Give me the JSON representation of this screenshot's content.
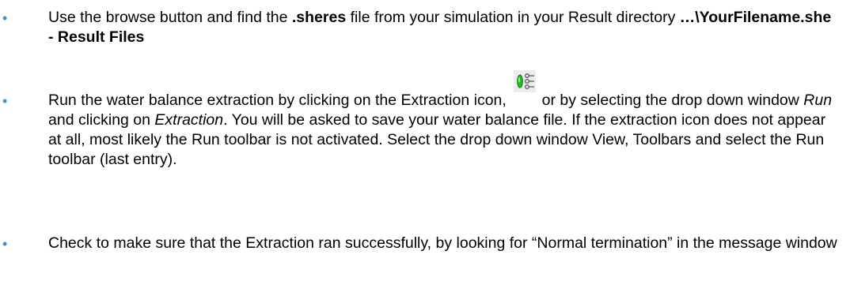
{
  "colors": {
    "bullet": "#3d8fd6",
    "icon_green": "#19c419",
    "icon_line": "#5a5a5a"
  },
  "bullets": {
    "marker": "•",
    "item1": {
      "p1": "Use the browse button and find the ",
      "b1": ".sheres",
      "p2": " file from your simulation in your Result directory ",
      "b2": "…\\YourFilename.she - Result Files"
    },
    "item2": {
      "p1": "Run the water balance extraction by clicking on the Extraction icon, ",
      "icon_name": "extraction-icon",
      "p2": " or by selecting the drop down window ",
      "i1": "Run",
      "p3": " and clicking on ",
      "i2": "Extraction",
      "p4": ". You will be asked to save your water balance file. If the extraction icon does not appear at all, most likely the Run toolbar is not activated. Select the drop down window View, Toolbars and select the Run toolbar (last entry)."
    },
    "item3": {
      "p1": "Check to make sure that the Extraction ran successfully, by looking for “Normal termination” in the message window"
    }
  }
}
